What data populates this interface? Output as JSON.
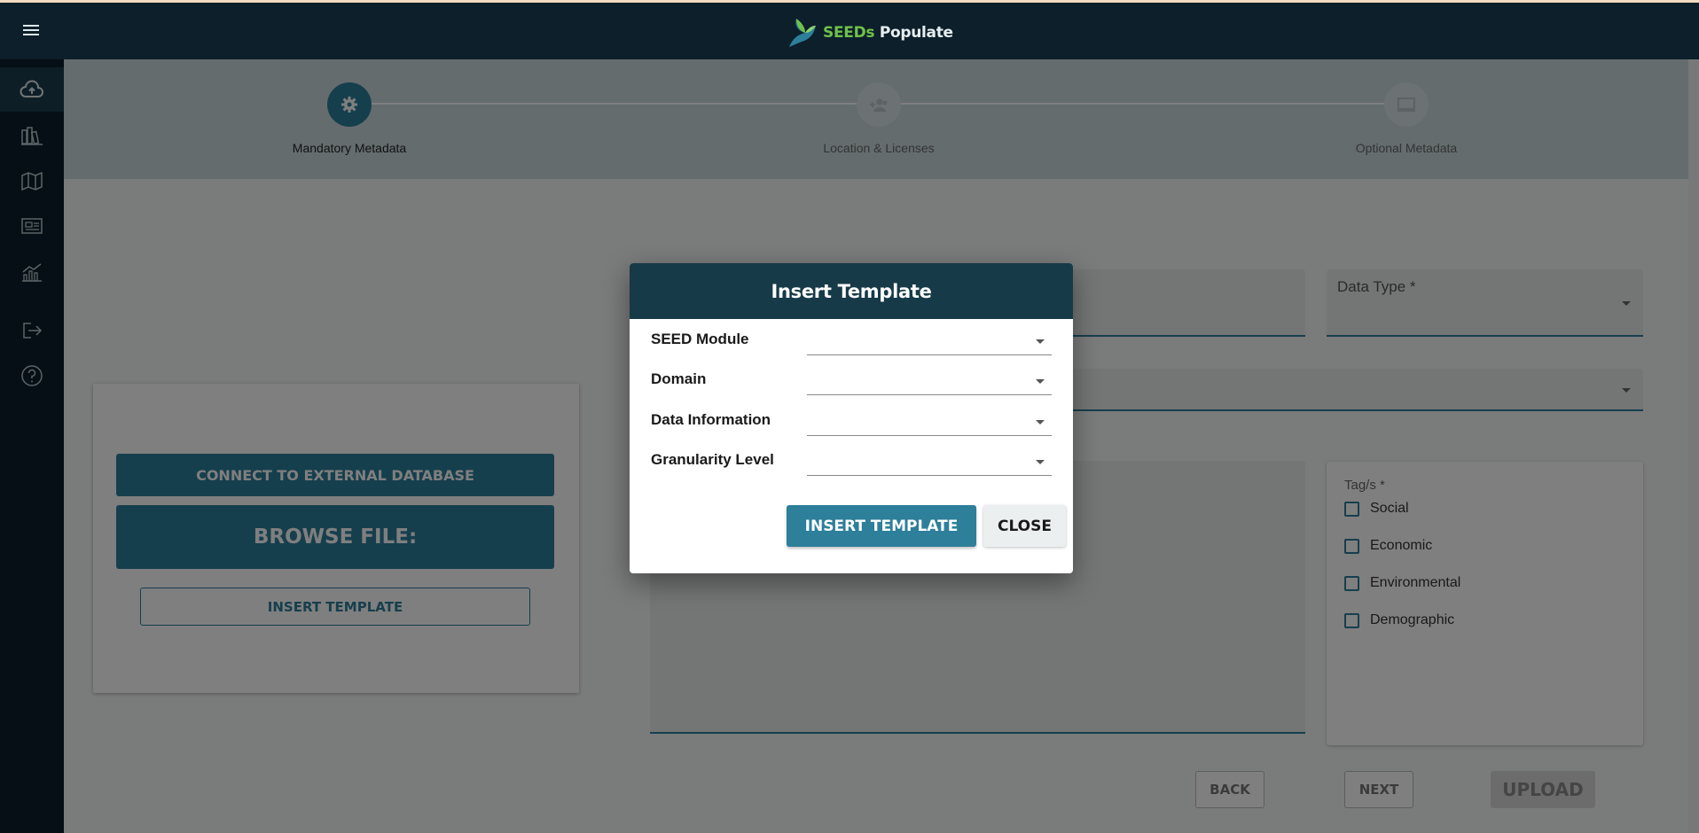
{
  "app": {
    "brand_highlight": "SEEDs",
    "brand_rest": " Populate"
  },
  "sidebar": {
    "items": [
      {
        "icon": "cloud-upload-icon",
        "active": true
      },
      {
        "icon": "books-icon",
        "active": false
      },
      {
        "icon": "map-icon",
        "active": false
      },
      {
        "icon": "dashboard-icon",
        "active": false
      },
      {
        "icon": "chart-icon",
        "active": false
      },
      {
        "icon": "logout-icon",
        "active": false
      },
      {
        "icon": "help-icon",
        "active": false
      }
    ]
  },
  "stepper": {
    "steps": [
      {
        "label": "Mandatory Metadata",
        "icon": "gear-icon",
        "active": true
      },
      {
        "label": "Location & Licenses",
        "icon": "group-add-icon",
        "active": false
      },
      {
        "label": "Optional Metadata",
        "icon": "monitor-icon",
        "active": false
      }
    ]
  },
  "upload": {
    "connect_label": "CONNECT TO EXTERNAL DATABASE",
    "browse_label": "BROWSE FILE:",
    "insert_template_label": "INSERT TEMPLATE"
  },
  "form": {
    "data_type_label": "Data Type *",
    "tags_title": "Tag/s *",
    "tags": [
      "Social",
      "Economic",
      "Environmental",
      "Demographic"
    ]
  },
  "nav": {
    "back_label": "BACK",
    "next_label": "NEXT",
    "upload_label": "UPLOAD"
  },
  "dialog": {
    "title": "Insert Template",
    "fields": [
      {
        "label": "SEED Module",
        "value": ""
      },
      {
        "label": "Domain",
        "value": ""
      },
      {
        "label": "Data Information",
        "value": ""
      },
      {
        "label": "Granularity Level",
        "value": ""
      }
    ],
    "insert_label": "INSERT TEMPLATE",
    "close_label": "CLOSE"
  },
  "colors": {
    "accent": "#2d7f9a",
    "dark": "#0c1f2a",
    "dialog_header": "#163a48",
    "brand_green": "#6fc14a"
  }
}
